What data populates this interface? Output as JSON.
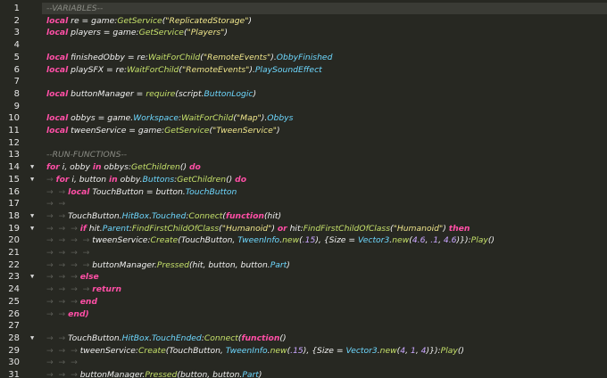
{
  "editor": {
    "lines": [
      {
        "n": "1",
        "fold": "",
        "tokens": [
          {
            "t": "--VARIABLES--",
            "c": "cmt"
          }
        ]
      },
      {
        "n": "2",
        "fold": "",
        "tokens": [
          {
            "t": "local",
            "c": "kw"
          },
          {
            "t": " re = ",
            "c": "id"
          },
          {
            "t": "game",
            "c": "id"
          },
          {
            "t": ":",
            "c": "pun"
          },
          {
            "t": "GetService",
            "c": "fn"
          },
          {
            "t": "(",
            "c": "pun"
          },
          {
            "t": "\"ReplicatedStorage\"",
            "c": "str"
          },
          {
            "t": ")",
            "c": "pun"
          }
        ]
      },
      {
        "n": "3",
        "fold": "",
        "tokens": [
          {
            "t": "local",
            "c": "kw"
          },
          {
            "t": " players = ",
            "c": "id"
          },
          {
            "t": "game",
            "c": "id"
          },
          {
            "t": ":",
            "c": "pun"
          },
          {
            "t": "GetService",
            "c": "fn"
          },
          {
            "t": "(",
            "c": "pun"
          },
          {
            "t": "\"Players\"",
            "c": "str"
          },
          {
            "t": ")",
            "c": "pun"
          }
        ]
      },
      {
        "n": "4",
        "fold": "",
        "tokens": []
      },
      {
        "n": "5",
        "fold": "",
        "tokens": [
          {
            "t": "local",
            "c": "kw"
          },
          {
            "t": " finishedObby = re:",
            "c": "id"
          },
          {
            "t": "WaitForChild",
            "c": "fn"
          },
          {
            "t": "(",
            "c": "pun"
          },
          {
            "t": "\"RemoteEvents\"",
            "c": "str"
          },
          {
            "t": ").",
            "c": "pun"
          },
          {
            "t": "ObbyFinished",
            "c": "prop"
          }
        ]
      },
      {
        "n": "6",
        "fold": "",
        "tokens": [
          {
            "t": "local",
            "c": "kw"
          },
          {
            "t": " playSFX = re:",
            "c": "id"
          },
          {
            "t": "WaitForChild",
            "c": "fn"
          },
          {
            "t": "(",
            "c": "pun"
          },
          {
            "t": "\"RemoteEvents\"",
            "c": "str"
          },
          {
            "t": ").",
            "c": "pun"
          },
          {
            "t": "PlaySoundEffect",
            "c": "prop"
          }
        ]
      },
      {
        "n": "7",
        "fold": "",
        "tokens": []
      },
      {
        "n": "8",
        "fold": "",
        "tokens": [
          {
            "t": "local",
            "c": "kw"
          },
          {
            "t": " buttonManager = ",
            "c": "id"
          },
          {
            "t": "require",
            "c": "fn"
          },
          {
            "t": "(script.",
            "c": "pun"
          },
          {
            "t": "ButtonLogic",
            "c": "prop"
          },
          {
            "t": ")",
            "c": "pun"
          }
        ]
      },
      {
        "n": "9",
        "fold": "",
        "tokens": []
      },
      {
        "n": "10",
        "fold": "",
        "tokens": [
          {
            "t": "local",
            "c": "kw"
          },
          {
            "t": " obbys = game.",
            "c": "id"
          },
          {
            "t": "Workspace",
            "c": "prop"
          },
          {
            "t": ":",
            "c": "pun"
          },
          {
            "t": "WaitForChild",
            "c": "fn"
          },
          {
            "t": "(",
            "c": "pun"
          },
          {
            "t": "\"Map\"",
            "c": "str"
          },
          {
            "t": ").",
            "c": "pun"
          },
          {
            "t": "Obbys",
            "c": "prop"
          }
        ]
      },
      {
        "n": "11",
        "fold": "",
        "tokens": [
          {
            "t": "local",
            "c": "kw"
          },
          {
            "t": " tweenService = game:",
            "c": "id"
          },
          {
            "t": "GetService",
            "c": "fn"
          },
          {
            "t": "(",
            "c": "pun"
          },
          {
            "t": "\"TweenService\"",
            "c": "str"
          },
          {
            "t": ")",
            "c": "pun"
          }
        ]
      },
      {
        "n": "12",
        "fold": "",
        "tokens": []
      },
      {
        "n": "13",
        "fold": "",
        "tokens": [
          {
            "t": "--RUN-FUNCTIONS--",
            "c": "cmt"
          }
        ]
      },
      {
        "n": "14",
        "fold": "▼",
        "tokens": [
          {
            "t": "for",
            "c": "kw"
          },
          {
            "t": " i, obby ",
            "c": "id"
          },
          {
            "t": "in",
            "c": "kw"
          },
          {
            "t": " obbys:",
            "c": "id"
          },
          {
            "t": "GetChildren",
            "c": "fn"
          },
          {
            "t": "() ",
            "c": "pun"
          },
          {
            "t": "do",
            "c": "kw"
          }
        ]
      },
      {
        "n": "15",
        "fold": "▼",
        "tokens": [
          {
            "t": "→ ",
            "c": "indent"
          },
          {
            "t": "for",
            "c": "kw"
          },
          {
            "t": " i, button ",
            "c": "id"
          },
          {
            "t": "in",
            "c": "kw"
          },
          {
            "t": " obby.",
            "c": "id"
          },
          {
            "t": "Buttons",
            "c": "prop"
          },
          {
            "t": ":",
            "c": "pun"
          },
          {
            "t": "GetChildren",
            "c": "fn"
          },
          {
            "t": "() ",
            "c": "pun"
          },
          {
            "t": "do",
            "c": "kw"
          }
        ]
      },
      {
        "n": "16",
        "fold": "",
        "tokens": [
          {
            "t": "→  → ",
            "c": "indent"
          },
          {
            "t": "local",
            "c": "kw"
          },
          {
            "t": " TouchButton = button.",
            "c": "id"
          },
          {
            "t": "TouchButton",
            "c": "prop"
          }
        ]
      },
      {
        "n": "17",
        "fold": "",
        "tokens": [
          {
            "t": "→  →",
            "c": "indent"
          }
        ]
      },
      {
        "n": "18",
        "fold": "▼",
        "tokens": [
          {
            "t": "→  → ",
            "c": "indent"
          },
          {
            "t": "TouchButton.",
            "c": "id"
          },
          {
            "t": "HitBox",
            "c": "prop"
          },
          {
            "t": ".",
            "c": "pun"
          },
          {
            "t": "Touched",
            "c": "prop"
          },
          {
            "t": ":",
            "c": "pun"
          },
          {
            "t": "Connect",
            "c": "fn"
          },
          {
            "t": "(",
            "c": "pun"
          },
          {
            "t": "function",
            "c": "kw"
          },
          {
            "t": "(hit)",
            "c": "id"
          }
        ]
      },
      {
        "n": "19",
        "fold": "▼",
        "tokens": [
          {
            "t": "→  →  → ",
            "c": "indent"
          },
          {
            "t": "if",
            "c": "kw"
          },
          {
            "t": " hit.",
            "c": "id"
          },
          {
            "t": "Parent",
            "c": "prop"
          },
          {
            "t": ":",
            "c": "pun"
          },
          {
            "t": "FindFirstChildOfClass",
            "c": "fn"
          },
          {
            "t": "(",
            "c": "pun"
          },
          {
            "t": "\"Humanoid\"",
            "c": "str"
          },
          {
            "t": ") ",
            "c": "pun"
          },
          {
            "t": "or",
            "c": "kw"
          },
          {
            "t": " hit:",
            "c": "id"
          },
          {
            "t": "FindFirstChildOfClass",
            "c": "fn"
          },
          {
            "t": "(",
            "c": "pun"
          },
          {
            "t": "\"Humanoid\"",
            "c": "str"
          },
          {
            "t": ") ",
            "c": "pun"
          },
          {
            "t": "then",
            "c": "kw"
          }
        ]
      },
      {
        "n": "20",
        "fold": "",
        "tokens": [
          {
            "t": "→  →  →  → ",
            "c": "indent"
          },
          {
            "t": "tweenService:",
            "c": "id"
          },
          {
            "t": "Create",
            "c": "fn"
          },
          {
            "t": "(TouchButton, ",
            "c": "id"
          },
          {
            "t": "TweenInfo",
            "c": "prop"
          },
          {
            "t": ".",
            "c": "pun"
          },
          {
            "t": "new",
            "c": "fn"
          },
          {
            "t": "(",
            "c": "pun"
          },
          {
            "t": ".15",
            "c": "num"
          },
          {
            "t": "), {Size = ",
            "c": "id"
          },
          {
            "t": "Vector3",
            "c": "prop"
          },
          {
            "t": ".",
            "c": "pun"
          },
          {
            "t": "new",
            "c": "fn"
          },
          {
            "t": "(",
            "c": "pun"
          },
          {
            "t": "4.6",
            "c": "num"
          },
          {
            "t": ", ",
            "c": "pun"
          },
          {
            "t": ".1",
            "c": "num"
          },
          {
            "t": ", ",
            "c": "pun"
          },
          {
            "t": "4.6",
            "c": "num"
          },
          {
            "t": ")}):",
            "c": "pun"
          },
          {
            "t": "Play",
            "c": "fn"
          },
          {
            "t": "()",
            "c": "pun"
          }
        ]
      },
      {
        "n": "21",
        "fold": "",
        "tokens": [
          {
            "t": "→  →  →  →",
            "c": "indent"
          }
        ]
      },
      {
        "n": "22",
        "fold": "",
        "tokens": [
          {
            "t": "→  →  →  → ",
            "c": "indent"
          },
          {
            "t": "buttonManager.",
            "c": "id"
          },
          {
            "t": "Pressed",
            "c": "fn"
          },
          {
            "t": "(hit, button, button.",
            "c": "id"
          },
          {
            "t": "Part",
            "c": "prop"
          },
          {
            "t": ")",
            "c": "pun"
          }
        ]
      },
      {
        "n": "23",
        "fold": "▼",
        "tokens": [
          {
            "t": "→  →  → ",
            "c": "indent"
          },
          {
            "t": "else",
            "c": "kw"
          }
        ]
      },
      {
        "n": "24",
        "fold": "",
        "tokens": [
          {
            "t": "→  →  →  → ",
            "c": "indent"
          },
          {
            "t": "return",
            "c": "kw"
          }
        ]
      },
      {
        "n": "25",
        "fold": "",
        "tokens": [
          {
            "t": "→  →  → ",
            "c": "indent"
          },
          {
            "t": "end",
            "c": "kw"
          }
        ]
      },
      {
        "n": "26",
        "fold": "",
        "tokens": [
          {
            "t": "→  → ",
            "c": "indent"
          },
          {
            "t": "end)",
            "c": "kw"
          }
        ]
      },
      {
        "n": "27",
        "fold": "",
        "tokens": []
      },
      {
        "n": "28",
        "fold": "▼",
        "tokens": [
          {
            "t": "→  → ",
            "c": "indent"
          },
          {
            "t": "TouchButton.",
            "c": "id"
          },
          {
            "t": "HitBox",
            "c": "prop"
          },
          {
            "t": ".",
            "c": "pun"
          },
          {
            "t": "TouchEnded",
            "c": "prop"
          },
          {
            "t": ":",
            "c": "pun"
          },
          {
            "t": "Connect",
            "c": "fn"
          },
          {
            "t": "(",
            "c": "pun"
          },
          {
            "t": "function",
            "c": "kw"
          },
          {
            "t": "()",
            "c": "pun"
          }
        ]
      },
      {
        "n": "29",
        "fold": "",
        "tokens": [
          {
            "t": "→  →  → ",
            "c": "indent"
          },
          {
            "t": "tweenService:",
            "c": "id"
          },
          {
            "t": "Create",
            "c": "fn"
          },
          {
            "t": "(TouchButton, ",
            "c": "id"
          },
          {
            "t": "TweenInfo",
            "c": "prop"
          },
          {
            "t": ".",
            "c": "pun"
          },
          {
            "t": "new",
            "c": "fn"
          },
          {
            "t": "(",
            "c": "pun"
          },
          {
            "t": ".15",
            "c": "num"
          },
          {
            "t": "), {Size = ",
            "c": "id"
          },
          {
            "t": "Vector3",
            "c": "prop"
          },
          {
            "t": ".",
            "c": "pun"
          },
          {
            "t": "new",
            "c": "fn"
          },
          {
            "t": "(",
            "c": "pun"
          },
          {
            "t": "4",
            "c": "num"
          },
          {
            "t": ", ",
            "c": "pun"
          },
          {
            "t": "1",
            "c": "num"
          },
          {
            "t": ", ",
            "c": "pun"
          },
          {
            "t": "4",
            "c": "num"
          },
          {
            "t": ")}):",
            "c": "pun"
          },
          {
            "t": "Play",
            "c": "fn"
          },
          {
            "t": "()",
            "c": "pun"
          }
        ]
      },
      {
        "n": "30",
        "fold": "",
        "tokens": [
          {
            "t": "→  →  →",
            "c": "indent"
          }
        ]
      },
      {
        "n": "31",
        "fold": "",
        "tokens": [
          {
            "t": "→  →  → ",
            "c": "indent"
          },
          {
            "t": "buttonManager.",
            "c": "id"
          },
          {
            "t": "Pressed",
            "c": "fn"
          },
          {
            "t": "(button, button.",
            "c": "id"
          },
          {
            "t": "Part",
            "c": "prop"
          },
          {
            "t": ")",
            "c": "pun"
          }
        ]
      }
    ]
  }
}
